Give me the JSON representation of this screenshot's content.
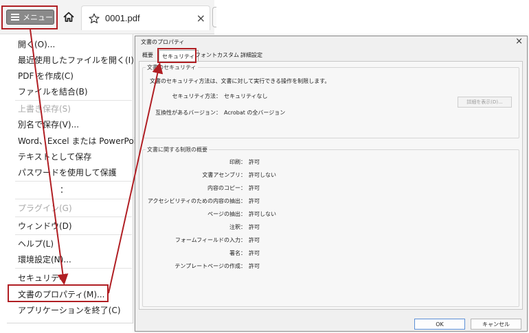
{
  "topbar": {
    "menu_label": "メニュー",
    "tab_title": "0001.pdf",
    "tab_close": "×"
  },
  "menu": {
    "items": [
      {
        "label": "開く(O)..."
      },
      {
        "label": "最近使用したファイルを開く(I)"
      },
      {
        "label": "PDF を作成(C)"
      },
      {
        "label": "ファイルを結合(B)"
      },
      {
        "label": "上書き保存(S)"
      },
      {
        "label": "別名で保存(V)..."
      },
      {
        "label": "Word、Excel または PowerPoint"
      },
      {
        "label": "テキストとして保存"
      },
      {
        "label": "パスワードを使用して保護"
      },
      {
        "label": "プラグイン(G)"
      },
      {
        "label": "ウィンドウ(D)"
      },
      {
        "label": "ヘルプ(L)"
      },
      {
        "label": "環境設定(N)..."
      },
      {
        "label": "セキュリティ"
      },
      {
        "label": "文書のプロパティ(M)..."
      },
      {
        "label": "アプリケーションを終了(C)"
      }
    ],
    "ellipsis": "："
  },
  "dialog": {
    "title": "文書のプロパティ",
    "close": "×",
    "tabs": [
      {
        "label": "概要"
      },
      {
        "label": "セキュリティ"
      },
      {
        "label": "フォント"
      },
      {
        "label": "カスタム"
      },
      {
        "label": "詳細設定"
      }
    ],
    "security_group": {
      "title": "文書のセキュリティ",
      "description": "文書のセキュリティ方法は、文書に対して実行できる操作を制限します。",
      "method_label": "セキュリティ方法：",
      "method_value": "セキュリティなし",
      "details_button": "詳細を表示(D)...",
      "compat_label": "互換性があるバージョン：",
      "compat_value": "Acrobat の全バージョン"
    },
    "restrictions_group": {
      "title": "文書に関する制限の概要",
      "rows": [
        {
          "label": "印刷：",
          "value": "許可"
        },
        {
          "label": "文書アセンブリ：",
          "value": "許可しない"
        },
        {
          "label": "内容のコピー：",
          "value": "許可"
        },
        {
          "label": "アクセシビリティのための内容の抽出：",
          "value": "許可"
        },
        {
          "label": "ページの抽出：",
          "value": "許可しない"
        },
        {
          "label": "注釈：",
          "value": "許可"
        },
        {
          "label": "フォームフィールドの入力：",
          "value": "許可"
        },
        {
          "label": "署名：",
          "value": "許可"
        },
        {
          "label": "テンプレートページの作成：",
          "value": "許可"
        }
      ]
    },
    "ok_label": "OK",
    "cancel_label": "キャンセル"
  },
  "colors": {
    "highlight": "#b01e23",
    "menu_button": "#8a8a8a",
    "disabled_text": "#a9a9a9"
  }
}
